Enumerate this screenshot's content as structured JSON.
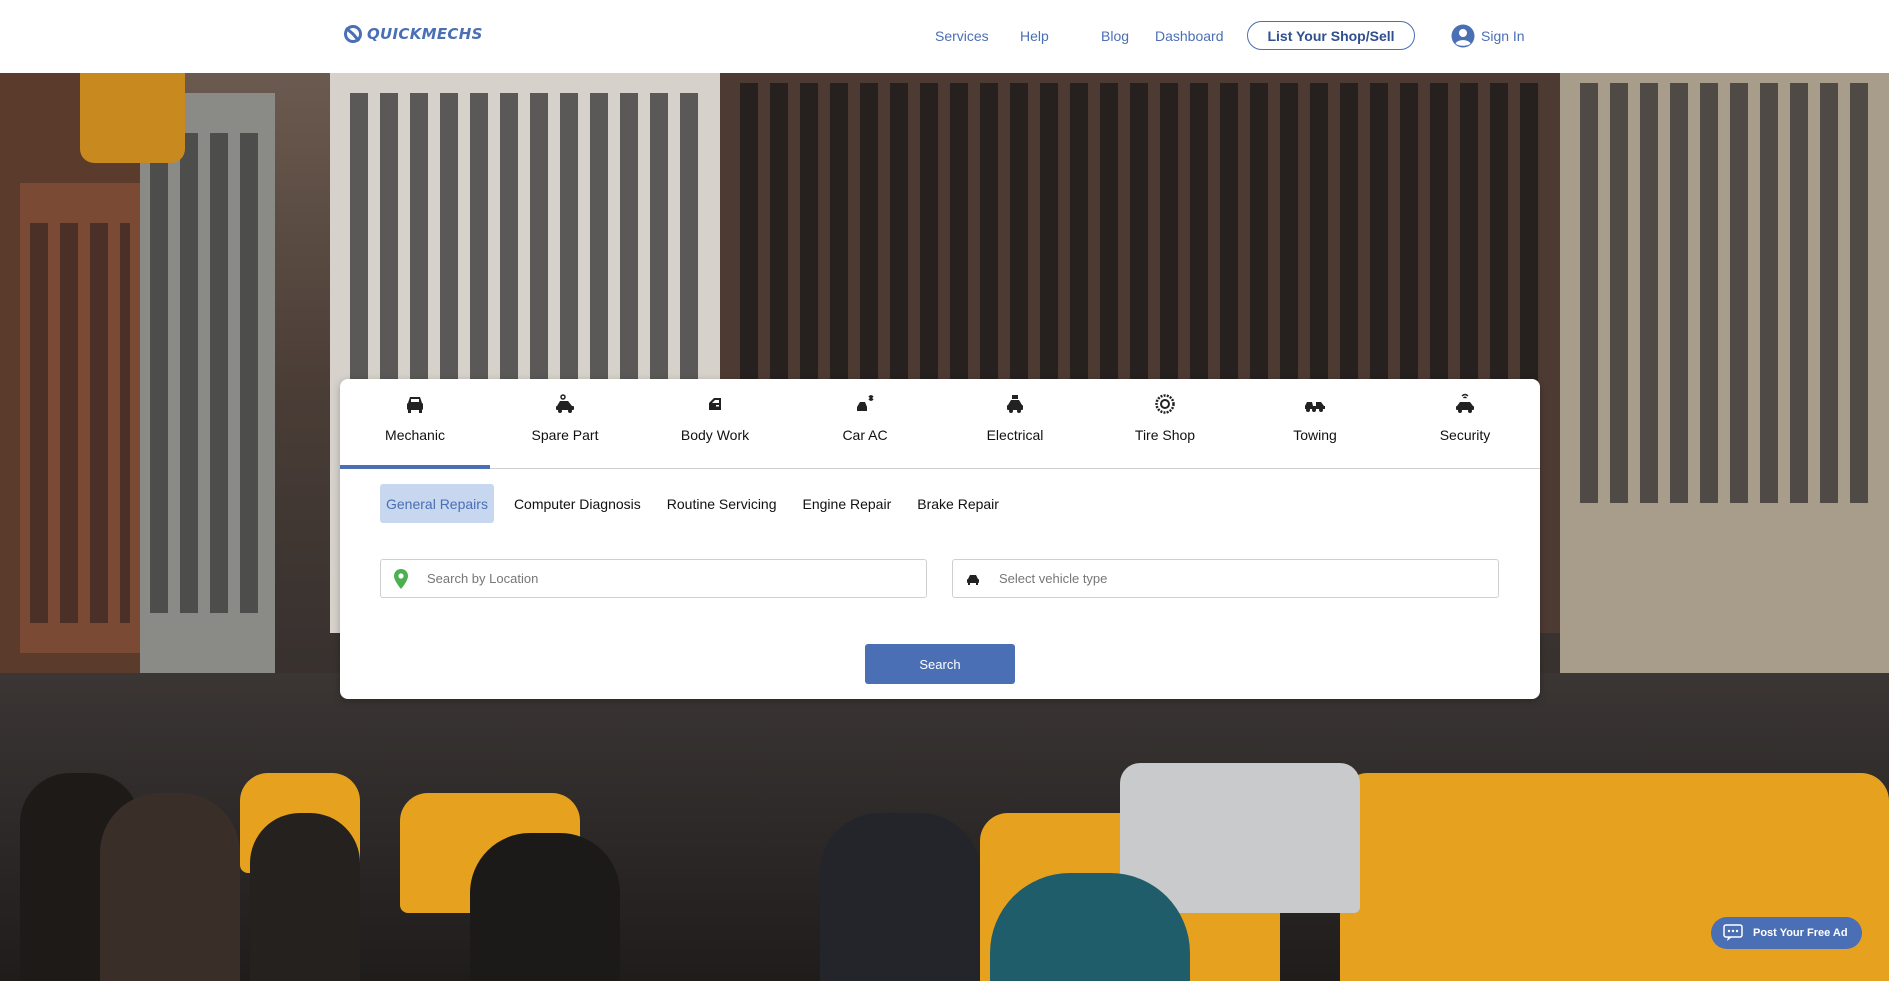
{
  "header": {
    "logo_text": "QUICKMECHS",
    "nav": {
      "services": "Services",
      "help": "Help",
      "blog": "Blog",
      "dashboard": "Dashboard"
    },
    "list_shop_label": "List Your Shop/Sell",
    "signin_label": "Sign In"
  },
  "categories": [
    {
      "label": "Mechanic",
      "icon": "car-front-icon"
    },
    {
      "label": "Spare Part",
      "icon": "car-parts-icon"
    },
    {
      "label": "Body Work",
      "icon": "car-door-icon"
    },
    {
      "label": "Car AC",
      "icon": "car-ac-icon"
    },
    {
      "label": "Electrical",
      "icon": "car-battery-icon"
    },
    {
      "label": "Tire Shop",
      "icon": "tire-icon"
    },
    {
      "label": "Towing",
      "icon": "tow-truck-icon"
    },
    {
      "label": "Security",
      "icon": "car-security-icon"
    }
  ],
  "active_category": "Mechanic",
  "subcategories": [
    "General Repairs",
    "Computer Diagnosis",
    "Routine Servicing",
    "Engine Repair",
    "Brake Repair"
  ],
  "active_subcategory": "General Repairs",
  "search": {
    "location_placeholder": "Search by Location",
    "vehicle_placeholder": "Select vehicle type",
    "button_label": "Search"
  },
  "post_ad_label": "Post Your Free Ad",
  "colors": {
    "brand": "#4a6fb5",
    "active_sub_bg": "#c7d7ef",
    "location_pin": "#4caf50"
  }
}
